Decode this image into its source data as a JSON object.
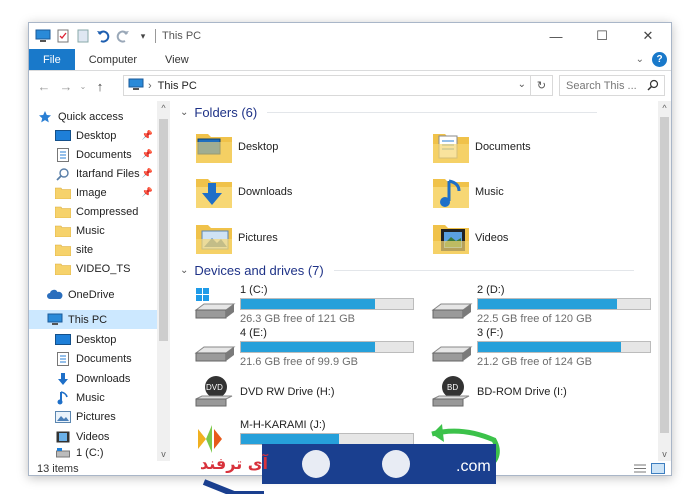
{
  "window": {
    "title": "This PC",
    "minimize_glyph": "—",
    "maximize_glyph": "☐",
    "close_glyph": "✕"
  },
  "ribbon": {
    "tabs": [
      "File",
      "Computer",
      "View"
    ]
  },
  "address": {
    "path": "This PC",
    "search_placeholder": "Search This ..."
  },
  "nav_pane": {
    "items": [
      {
        "label": "Quick access",
        "icon": "star-icon",
        "pinned": false
      },
      {
        "label": "Desktop",
        "icon": "desktop-icon",
        "pinned": true
      },
      {
        "label": "Documents",
        "icon": "documents-icon",
        "pinned": true
      },
      {
        "label": "Itarfand Files",
        "icon": "search-folder-icon",
        "pinned": true
      },
      {
        "label": "Image",
        "icon": "folder-icon",
        "pinned": true
      },
      {
        "label": "Compressed",
        "icon": "folder-icon",
        "pinned": false
      },
      {
        "label": "Music",
        "icon": "folder-icon",
        "pinned": false
      },
      {
        "label": "site",
        "icon": "folder-icon",
        "pinned": false
      },
      {
        "label": "VIDEO_TS",
        "icon": "folder-icon",
        "pinned": false
      },
      {
        "label": "OneDrive",
        "icon": "cloud-icon",
        "pinned": false
      },
      {
        "label": "This PC",
        "icon": "pc-icon",
        "pinned": false
      },
      {
        "label": "Desktop",
        "icon": "desktop-icon",
        "pinned": false
      },
      {
        "label": "Documents",
        "icon": "documents-icon",
        "pinned": false
      },
      {
        "label": "Downloads",
        "icon": "downloads-icon",
        "pinned": false
      },
      {
        "label": "Music",
        "icon": "music-icon",
        "pinned": false
      },
      {
        "label": "Pictures",
        "icon": "pictures-icon",
        "pinned": false
      },
      {
        "label": "Videos",
        "icon": "videos-icon",
        "pinned": false
      },
      {
        "label": "1 (C:)",
        "icon": "drive-icon",
        "pinned": false
      }
    ]
  },
  "folders": {
    "header": "Folders (6)",
    "items": [
      {
        "label": "Desktop",
        "icon": "desktop-folder-icon"
      },
      {
        "label": "Documents",
        "icon": "documents-folder-icon"
      },
      {
        "label": "Downloads",
        "icon": "downloads-folder-icon"
      },
      {
        "label": "Music",
        "icon": "music-folder-icon"
      },
      {
        "label": "Pictures",
        "icon": "pictures-folder-icon"
      },
      {
        "label": "Videos",
        "icon": "videos-folder-icon"
      }
    ]
  },
  "drives": {
    "header": "Devices and drives (7)",
    "items": [
      {
        "name": "1 (C:)",
        "free": "26.3 GB free of 121 GB",
        "used_fraction": 0.78,
        "icon": "windows-drive-icon"
      },
      {
        "name": "2 (D:)",
        "free": "22.5 GB free of 120 GB",
        "used_fraction": 0.81,
        "icon": "drive-icon"
      },
      {
        "name": "4 (E:)",
        "free": "21.6 GB free of 99.9 GB",
        "used_fraction": 0.78,
        "icon": "drive-icon"
      },
      {
        "name": "3 (F:)",
        "free": "21.2 GB free of 124 GB",
        "used_fraction": 0.83,
        "icon": "drive-icon"
      },
      {
        "name": "DVD RW Drive (H:)",
        "icon": "dvd-drive-icon"
      },
      {
        "name": "BD-ROM Drive (I:)",
        "icon": "bd-drive-icon"
      },
      {
        "name": "M-H-KARAMI (J:)",
        "used_fraction": 0.57,
        "icon": "usb-drive-icon"
      }
    ]
  },
  "status": {
    "items_count": "13 items"
  },
  "watermark": {
    "text": "آی ترفند",
    "suffix": ".com"
  },
  "colors": {
    "accent": "#1979ca",
    "bar_fill": "#26a0da",
    "group_header": "#1e3287",
    "selection": "#cce8ff"
  }
}
